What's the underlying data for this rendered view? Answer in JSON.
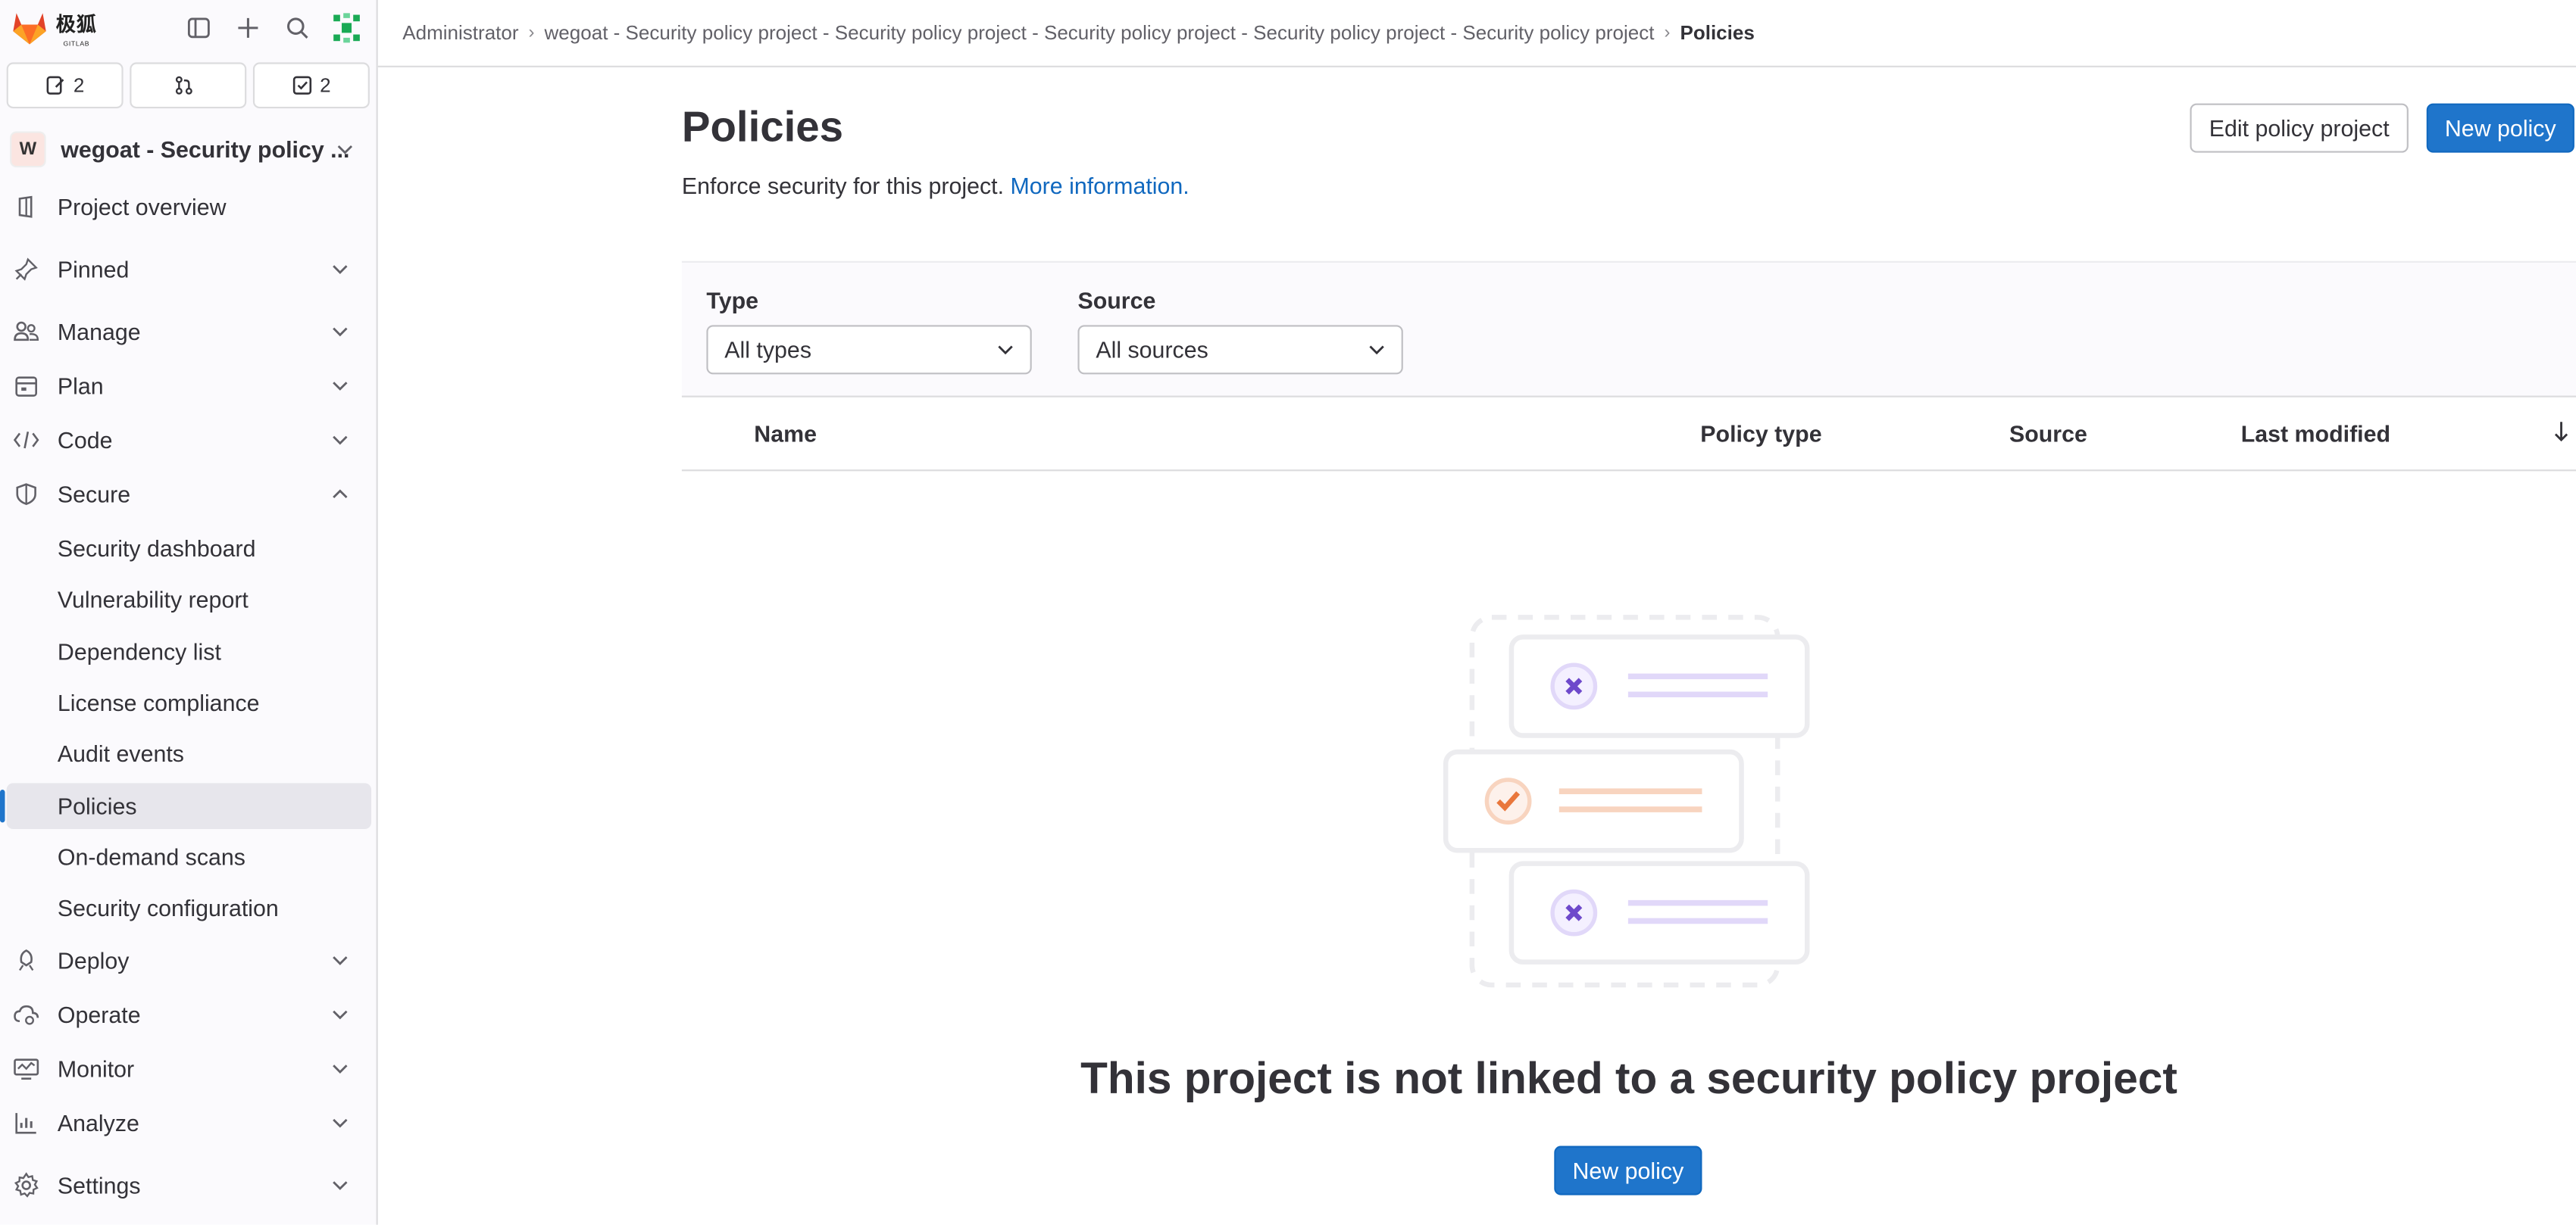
{
  "brand": {
    "logo_text": "极狐",
    "logo_sub": "GITLAB"
  },
  "sidebar": {
    "counts": [
      {
        "icon": "issues-icon",
        "count": "2"
      },
      {
        "icon": "merge-request-icon",
        "count": ""
      },
      {
        "icon": "todo-icon",
        "count": "2"
      }
    ],
    "project": {
      "avatar": "W",
      "name": "wegoat - Security policy ..."
    },
    "items": [
      {
        "label": "Project overview",
        "icon": "project-icon"
      },
      {
        "label": "Pinned",
        "icon": "pin-icon"
      },
      {
        "label": "Manage",
        "icon": "users-icon"
      },
      {
        "label": "Plan",
        "icon": "planning-icon"
      },
      {
        "label": "Code",
        "icon": "code-icon"
      },
      {
        "label": "Secure",
        "icon": "shield-icon"
      },
      {
        "label": "Security dashboard"
      },
      {
        "label": "Vulnerability report"
      },
      {
        "label": "Dependency list"
      },
      {
        "label": "License compliance"
      },
      {
        "label": "Audit events"
      },
      {
        "label": "Policies"
      },
      {
        "label": "On-demand scans"
      },
      {
        "label": "Security configuration"
      },
      {
        "label": "Deploy",
        "icon": "deploy-icon"
      },
      {
        "label": "Operate",
        "icon": "cloud-gear-icon"
      },
      {
        "label": "Monitor",
        "icon": "monitor-icon"
      },
      {
        "label": "Analyze",
        "icon": "chart-icon"
      },
      {
        "label": "Settings",
        "icon": "gear-icon"
      }
    ]
  },
  "breadcrumb": {
    "root": "Administrator",
    "project": "wegoat - Security policy project - Security policy project - Security policy project - Security policy project - Security policy project",
    "current": "Policies"
  },
  "page": {
    "title": "Policies",
    "description": "Enforce security for this project.",
    "more_link": "More information.",
    "edit_button": "Edit policy project",
    "new_button": "New policy"
  },
  "filters": {
    "type_label": "Type",
    "type_value": "All types",
    "source_label": "Source",
    "source_value": "All sources"
  },
  "table": {
    "columns": [
      "Name",
      "Policy type",
      "Source",
      "Last modified"
    ]
  },
  "empty_state": {
    "title": "This project is not linked to a security policy project",
    "button": "New policy"
  },
  "colors": {
    "primary": "#1f75cb",
    "link": "#1068bf",
    "accent_orange": "#e9773c",
    "accent_purple": "#6e49cb"
  }
}
